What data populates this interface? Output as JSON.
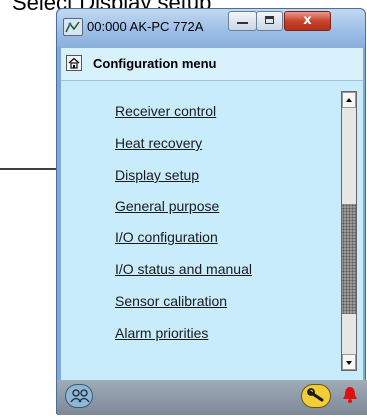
{
  "caption": "Select Display setup",
  "window": {
    "title": "00:000 AK-PC 772A",
    "close_glyph": "x",
    "minimize_icon": "minimize-icon",
    "maximize_icon": "maximize-icon"
  },
  "header": {
    "home_icon": "home-icon",
    "title": "Configuration menu"
  },
  "menu": {
    "items": [
      {
        "label": "Receiver control"
      },
      {
        "label": "Heat recovery"
      },
      {
        "label": "Display setup"
      },
      {
        "label": "General purpose"
      },
      {
        "label": "I/O configuration"
      },
      {
        "label": "I/O status and manual"
      },
      {
        "label": "Sensor calibration"
      },
      {
        "label": "Alarm priorities"
      }
    ]
  },
  "statusbar": {
    "left_icon": "people-icon",
    "right_icon": "wrench-icon",
    "alarm_icon": "alarm-bell-icon"
  },
  "colors": {
    "client_background": "#c8ecfb",
    "title_bar": "#9ebfe6",
    "close_button": "#c8432c",
    "wrench_button": "#f2cd38",
    "alarm": "#e01010"
  }
}
